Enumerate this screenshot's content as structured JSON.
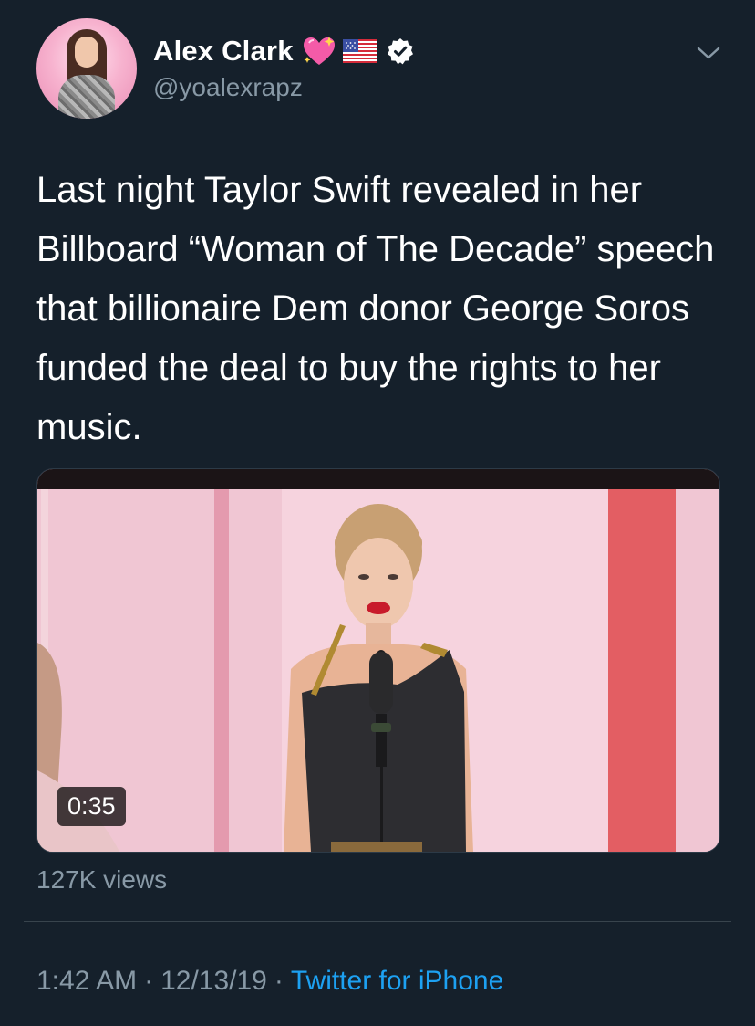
{
  "header": {
    "name": "Alex Clark",
    "handle": "@yoalexrapz",
    "verified": true,
    "icons": [
      "avatar",
      "sparkling-heart-emoji",
      "us-flag-emoji",
      "verified-badge-icon",
      "chevron-down-icon"
    ]
  },
  "tweet": {
    "text": "Last night Taylor Swift revealed in her Billboard “Woman of The Decade” speech that billionaire Dem donor George Soros funded the deal to buy the rights to her music."
  },
  "media": {
    "duration": "0:35",
    "views": "127K views"
  },
  "footer": {
    "time": "1:42 AM",
    "separator": "·",
    "date": "12/13/19",
    "source": "Twitter for iPhone"
  },
  "colors": {
    "background": "#15202b",
    "text": "#ffffff",
    "secondary_text": "#8899a6",
    "link": "#1da1f2",
    "divider": "#38444d"
  }
}
